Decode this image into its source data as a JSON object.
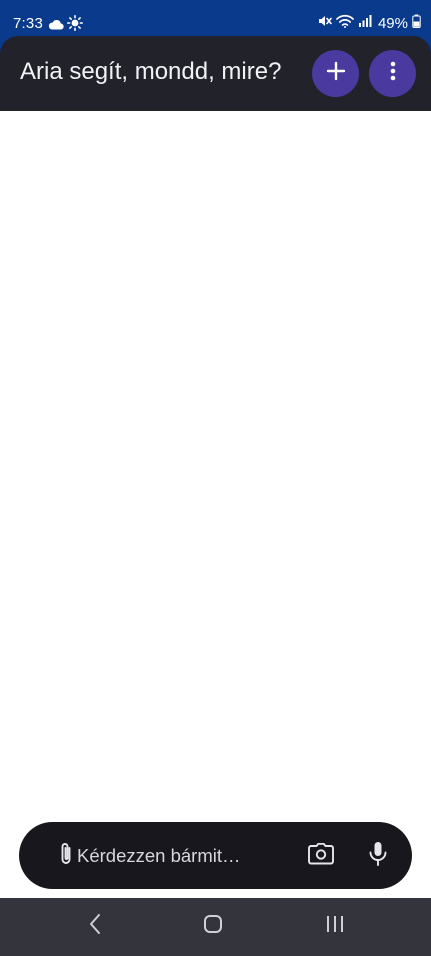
{
  "status_bar": {
    "time": "7:33",
    "battery": "49%",
    "left_icons": [
      "cloud-icon",
      "sun-icon"
    ],
    "right_icons": [
      "mute-icon",
      "wifi-icon",
      "signal-icon",
      "battery-icon"
    ]
  },
  "header": {
    "title": "Aria segít, mondd, mire?",
    "add_icon": "plus-icon",
    "menu_icon": "more-vertical-icon",
    "accent_color": "#4a3aa0",
    "background": "#22222a"
  },
  "composer": {
    "placeholder": "Kérdezzen bármit…",
    "value": "",
    "attach_icon": "paperclip-icon",
    "camera_icon": "camera-icon",
    "mic_icon": "microphone-icon"
  },
  "nav_bar": {
    "back_icon": "back-icon",
    "home_icon": "home-icon",
    "recents_icon": "recents-icon"
  }
}
